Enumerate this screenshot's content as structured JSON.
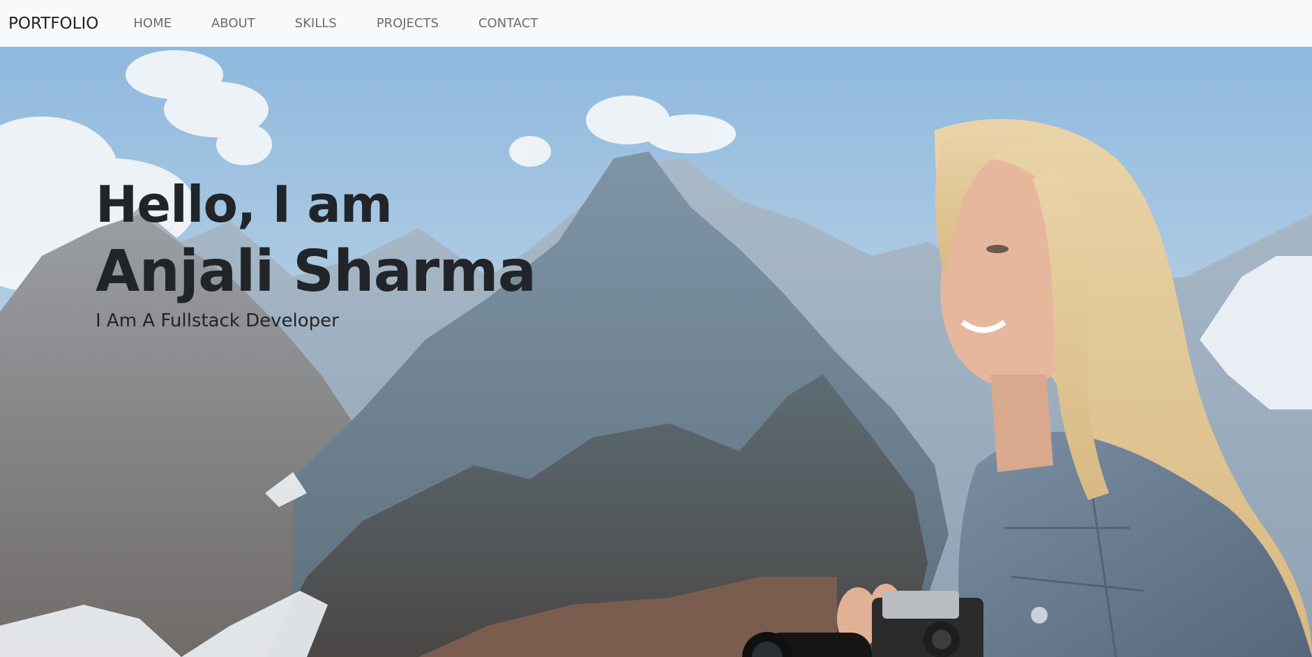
{
  "nav": {
    "brand": "PORTFOLIO",
    "links": [
      "HOME",
      "ABOUT",
      "SKILLS",
      "PROJECTS",
      "CONTACT"
    ]
  },
  "hero": {
    "greeting": "Hello, I am",
    "name": "Anjali Sharma",
    "role": "I Am A Fullstack Developer"
  },
  "colors": {
    "navbar_bg": "#f8f9fa",
    "text_dark": "#212529",
    "nav_link": "#6c6c6c"
  }
}
